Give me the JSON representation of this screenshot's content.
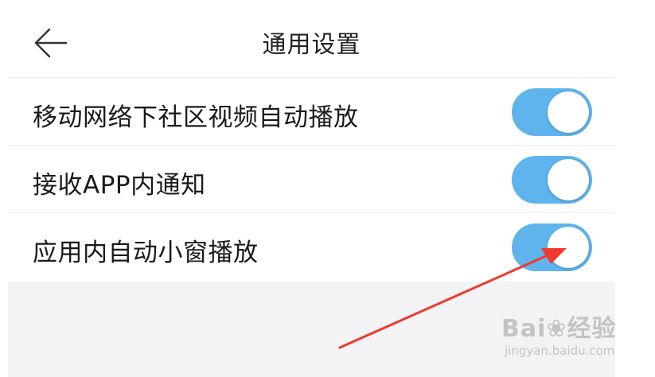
{
  "header": {
    "title": "通用设置",
    "back_icon": "back-arrow-icon"
  },
  "settings": [
    {
      "label": "移动网络下社区视频自动播放",
      "enabled": true
    },
    {
      "label": "接收APP内通知",
      "enabled": true
    },
    {
      "label": "应用内自动小窗播放",
      "enabled": true
    }
  ],
  "watermark": {
    "brand": "Bai",
    "brand_suffix": "经验",
    "url": "jingyan.baidu.com",
    "icon": "paw-icon"
  },
  "colors": {
    "toggle_on": "#5fb4ee",
    "background_gray": "#f3f3f5",
    "annotation_arrow": "#f03a2e"
  }
}
